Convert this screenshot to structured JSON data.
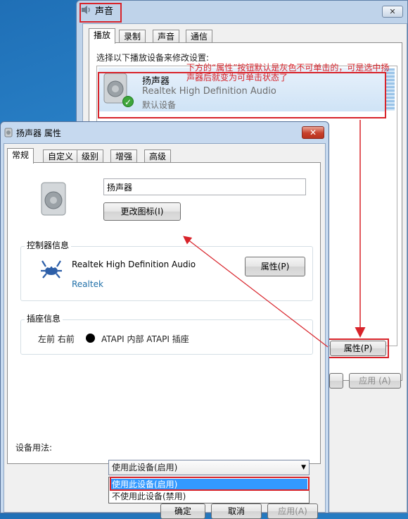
{
  "sound_window": {
    "title": "声音",
    "tabs": [
      "播放",
      "录制",
      "声音",
      "通信"
    ],
    "instruction": "选择以下播放设备来修改设置:",
    "device": {
      "name": "扬声器",
      "driver": "Realtek High Definition Audio",
      "status": "默认设备"
    },
    "annotation": "下方的“属性”按钮默认是灰色不可单击的，可是选中扬声器后就变为可单击状态了",
    "properties_button": "属性(P)",
    "apply_button": "应用 (A)",
    "close_label": "✕"
  },
  "props_window": {
    "title": "扬声器 属性",
    "close_label": "✕",
    "tabs": [
      "常规",
      "自定义",
      "级别",
      "增强",
      "高级"
    ],
    "name_field": "扬声器",
    "change_icon_button": "更改图标(I)",
    "controller": {
      "group_label": "控制器信息",
      "name": "Realtek High Definition Audio",
      "vendor": "Realtek",
      "properties_button": "属性(P)"
    },
    "jack": {
      "group_label": "插座信息",
      "position": "左前 右前",
      "description": "ATAPI 内部 ATAPI 插座"
    },
    "usage": {
      "label": "设备用法:",
      "selected": "使用此设备(启用)",
      "options": [
        "使用此设备(启用)",
        "不使用此设备(禁用)"
      ]
    },
    "ok_button": "确定",
    "cancel_button": "取消",
    "apply_button": "应用(A)"
  },
  "colors": {
    "highlight": "#d8232a",
    "selection": "#3399ff",
    "link": "#1f6fa8"
  },
  "icons": {
    "sound": "speaker-icon",
    "check": "check-icon",
    "realtek": "realtek-crab-icon"
  }
}
